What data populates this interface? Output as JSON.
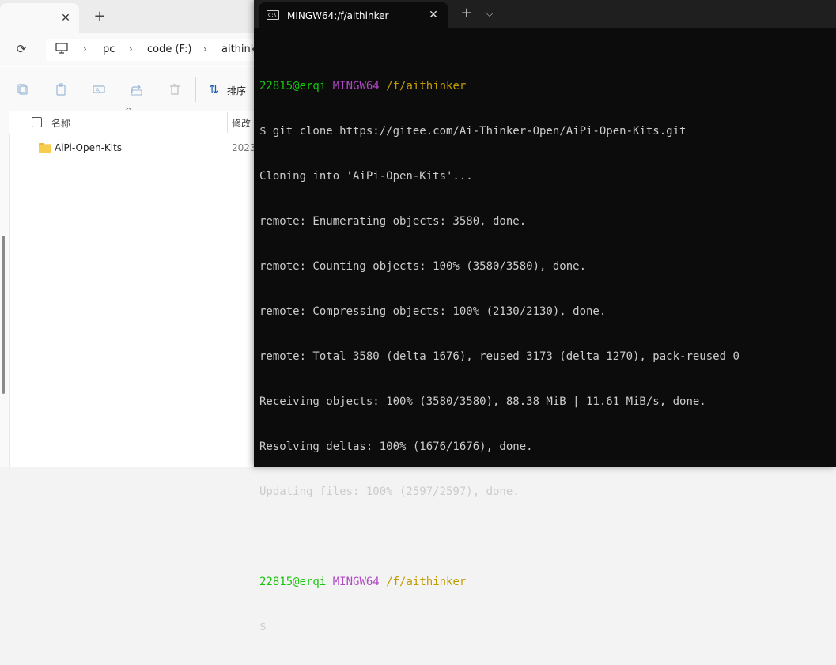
{
  "explorer": {
    "tab_close": "✕",
    "new_tab": "+",
    "breadcrumbs": [
      "pc",
      "code (F:)",
      "aithink"
    ],
    "sort_label": "排序",
    "columns": {
      "name": "名称",
      "modified": "修改"
    },
    "items": [
      {
        "name": "AiPi-Open-Kits",
        "date": "2023"
      }
    ]
  },
  "terminal": {
    "tab_title": "MINGW64:/f/aithinker",
    "tab_icon_text": "C:\\",
    "close": "✕",
    "new_tab": "+",
    "dropdown": "⌵",
    "colors": {
      "user": "#16c60c",
      "env": "#b148c6",
      "path": "#c19c00",
      "text": "#cccccc",
      "bg": "#0c0c0c"
    },
    "prompt1": {
      "user": "22815@erqi",
      "env": "MINGW64",
      "path": "/f/aithinker"
    },
    "command": "$ git clone https://gitee.com/Ai-Thinker-Open/AiPi-Open-Kits.git",
    "output": [
      "Cloning into 'AiPi-Open-Kits'...",
      "remote: Enumerating objects: 3580, done.",
      "remote: Counting objects: 100% (3580/3580), done.",
      "remote: Compressing objects: 100% (2130/2130), done.",
      "remote: Total 3580 (delta 1676), reused 3173 (delta 1270), pack-reused 0",
      "Receiving objects: 100% (3580/3580), 88.38 MiB | 11.61 MiB/s, done.",
      "Resolving deltas: 100% (1676/1676), done.",
      "Updating files: 100% (2597/2597), done."
    ],
    "prompt2": {
      "user": "22815@erqi",
      "env": "MINGW64",
      "path": "/f/aithinker"
    },
    "cursor_line": "$"
  }
}
